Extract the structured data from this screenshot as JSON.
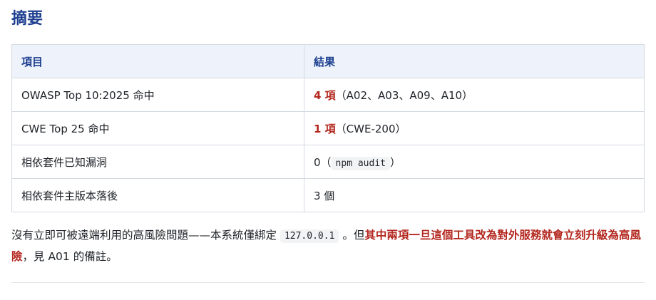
{
  "section": {
    "title": "摘要"
  },
  "table": {
    "headers": [
      "項目",
      "結果"
    ],
    "rows": [
      {
        "item": "OWASP Top 10:2025 命中",
        "result_highlight": "4 項",
        "result_rest": "（A02、A03、A09、A10）"
      },
      {
        "item": "CWE Top 25 命中",
        "result_highlight": "1 項",
        "result_rest": "（CWE-200）"
      },
      {
        "item": "相依套件已知漏洞",
        "result_prefix": "0（",
        "result_code": "npm audit",
        "result_suffix": "）"
      },
      {
        "item": "相依套件主版本落後",
        "result_plain": "3 個"
      }
    ]
  },
  "note": {
    "part1": "沒有立即可被遠端利用的高風險問題——本系統僅綁定 ",
    "code": "127.0.0.1",
    "part2": " 。但",
    "warning": "其中兩項一旦這個工具改為對外服務就會立刻升級為高風險",
    "part3": "，見 A01 的備註。"
  },
  "colors": {
    "heading": "#1d3f8f",
    "header_bg": "#eef3fb",
    "highlight_red": "#b3261e",
    "border": "#d4dae3"
  }
}
